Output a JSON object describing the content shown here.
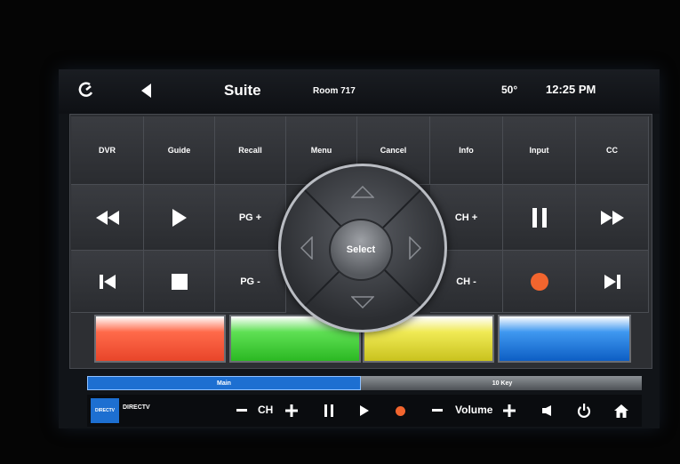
{
  "header": {
    "title": "Suite",
    "room": "Room 717",
    "temperature": "50°",
    "time": "12:25 PM"
  },
  "keypad": {
    "row1": [
      "DVR",
      "Guide",
      "Recall",
      "Menu",
      "Cancel",
      "Info",
      "Input",
      "CC"
    ],
    "pg_up": "PG +",
    "pg_down": "PG -",
    "ch_up": "CH +",
    "ch_down": "CH -",
    "select": "Select"
  },
  "color_buttons": [
    "#ff5a3c",
    "#46d23c",
    "#e6e03a",
    "#2f7fe0"
  ],
  "tabs": {
    "main": "Main",
    "ten_key": "10 Key"
  },
  "bottom": {
    "source_badge": "DIRECTV",
    "source_label": "DIRECTV",
    "ch_label": "CH",
    "volume_label": "Volume"
  },
  "colors": {
    "record": "#f2652e",
    "tab_active": "#1d6fd1"
  },
  "icons": [
    "logo-icon",
    "back-icon",
    "rewind-icon",
    "play-icon",
    "pause-icon",
    "fast-forward-icon",
    "skip-back-icon",
    "stop-icon",
    "record-icon",
    "skip-forward-icon",
    "up-arrow-icon",
    "down-arrow-icon",
    "left-arrow-icon",
    "right-arrow-icon",
    "minus-icon",
    "plus-icon",
    "mute-icon",
    "power-icon",
    "home-icon"
  ]
}
